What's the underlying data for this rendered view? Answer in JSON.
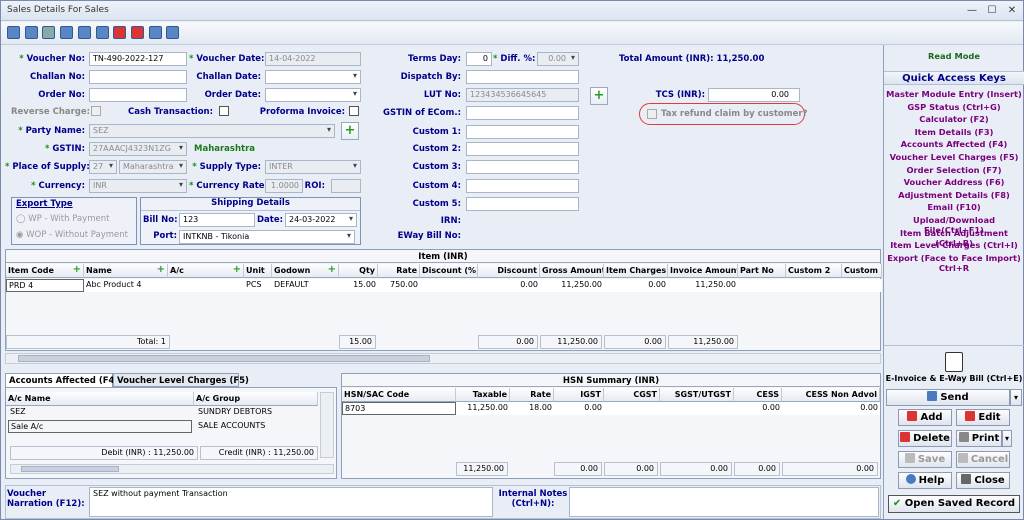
{
  "window": {
    "title": "Sales Details For Sales",
    "minimize": "—",
    "maximize": "☐",
    "close": "✕"
  },
  "form": {
    "voucher_no_label": "Voucher No:",
    "voucher_no": "TN-490-2022-127",
    "voucher_date_label": "Voucher Date:",
    "voucher_date": "14-04-2022",
    "challan_no_label": "Challan No:",
    "challan_date_label": "Challan Date:",
    "order_no_label": "Order No:",
    "order_date_label": "Order Date:",
    "reverse_charge_label": "Reverse Charge:",
    "cash_transaction_label": "Cash Transaction:",
    "proforma_invoice_label": "Proforma Invoice:",
    "party_name_label": "Party Name:",
    "party_name": "SEZ",
    "gstin_label": "GSTIN:",
    "gstin": "27AAACJ4323N1ZG",
    "gstin_state": "Maharashtra",
    "place_of_supply_label": "Place of Supply:",
    "place_code": "27",
    "place_state": "Maharashtra",
    "supply_type_label": "Supply Type:",
    "supply_type": "INTER",
    "currency_label": "Currency:",
    "currency": "INR",
    "currency_rate_label": "Currency Rate:",
    "currency_rate": "1.0000",
    "roi_label": "ROI:",
    "terms_day_label": "Terms Day:",
    "terms_day": "0",
    "diff_label": "Diff. %:",
    "diff": "0.00",
    "dispatch_by_label": "Dispatch By:",
    "lut_no_label": "LUT No:",
    "lut_no": "123434536645645",
    "gstin_ecom_label": "GSTIN of ECom.:",
    "custom1": "Custom 1:",
    "custom2": "Custom 2:",
    "custom3": "Custom 3:",
    "custom4": "Custom 4:",
    "custom5": "Custom 5:",
    "irn_label": "IRN:",
    "eway_label": "EWay Bill No:",
    "total_amount": "Total Amount (INR): 11,250.00",
    "tcs_label": "TCS (INR):",
    "tcs": "0.00",
    "tax_refund_label": "Tax refund claim by customer?"
  },
  "export_type": {
    "title": "Export Type",
    "wp": "WP - With Payment",
    "wop": "WOP - Without Payment"
  },
  "shipping": {
    "title": "Shipping Details",
    "bill_no_label": "Bill No:",
    "bill_no": "123",
    "date_label": "Date:",
    "date": "24-03-2022",
    "port_label": "Port:",
    "port": "INTKNB - Tikonia"
  },
  "items": {
    "title": "Item (INR)",
    "headers": [
      "Item Code",
      "Name",
      "A/c",
      "Unit",
      "Godown",
      "Qty",
      "Rate",
      "Discount (%)",
      "Discount",
      "Gross Amount",
      "Item Charges",
      "Invoice Amount",
      "Part No",
      "Custom 2",
      "Custom 3"
    ],
    "rows": [
      [
        "PRD 4",
        "Abc Product 4",
        "",
        "PCS",
        "DEFAULT",
        "15.00",
        "750.00",
        "",
        "0.00",
        "11,250.00",
        "0.00",
        "11,250.00",
        "",
        "",
        ""
      ]
    ],
    "total_label": "Total: 1",
    "total_qty": "15.00",
    "total_discount": "0.00",
    "total_gross": "11,250.00",
    "total_charges": "0.00",
    "total_invoice": "11,250.00"
  },
  "accounts": {
    "tab1": "Accounts Affected (F4)",
    "tab2": "Voucher Level Charges (F5)",
    "headers": [
      "A/c Name",
      "A/c Group"
    ],
    "rows": [
      [
        "SEZ",
        "SUNDRY DEBTORS"
      ],
      [
        "Sale A/c",
        "SALE ACCOUNTS"
      ]
    ],
    "debit": "Debit (INR) : 11,250.00",
    "credit": "Credit (INR) : 11,250.00"
  },
  "hsn": {
    "title": "HSN Summary (INR)",
    "headers": [
      "HSN/SAC Code",
      "Taxable",
      "Rate",
      "IGST",
      "CGST",
      "SGST/UTGST",
      "CESS",
      "CESS Non Advol"
    ],
    "row": [
      "8703",
      "11,250.00",
      "18.00",
      "0.00",
      "",
      "",
      "0.00",
      "0.00"
    ],
    "totals": [
      "11,250.00",
      "0.00",
      "0.00",
      "0.00",
      "0.00",
      "0.00"
    ]
  },
  "narration": {
    "label": "Voucher Narration (F12):",
    "value": "SEZ without payment Transaction",
    "notes_label": "Internal Notes (Ctrl+N):"
  },
  "sidebar": {
    "mode": "Read Mode",
    "qa_title": "Quick Access Keys",
    "links": [
      "Master Module Entry (Insert)",
      "GSP Status (Ctrl+G)",
      "Calculator (F2)",
      "Item Details (F3)",
      "Accounts Affected (F4)",
      "Voucher Level Charges (F5)",
      "Order Selection (F7)",
      "Voucher Address (F6)",
      "Adjustment Details (F8)",
      "Email (F10)",
      "Upload/Download File(Ctrl+F1)",
      "Item Batch Adjustment (Ctrl+B)",
      "Item Level Charges (Ctrl+I)",
      "Export (Face to Face Import) Ctrl+R"
    ],
    "einvoice": "E-Invoice & E-Way Bill (Ctrl+E)",
    "send": "Send",
    "add": "Add",
    "edit": "Edit",
    "delete": "Delete",
    "print": "Print",
    "save": "Save",
    "cancel": "Cancel",
    "help": "Help",
    "close": "Close",
    "open_saved": "Open Saved Record"
  },
  "colors": {
    "label": "#00008b",
    "accent_purple": "#7a007a",
    "mode_green": "#1a6a1a",
    "highlight_red": "#e03a3a"
  }
}
